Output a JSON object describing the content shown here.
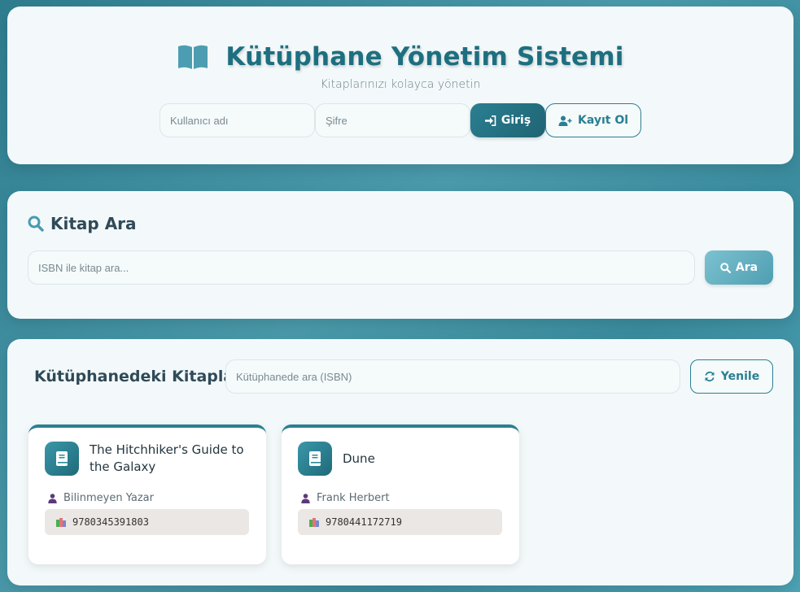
{
  "header": {
    "title": "Kütüphane Yönetim Sistemi",
    "subtitle": "Kitaplarınızı kolayca yönetin",
    "username_placeholder": "Kullanıcı adı",
    "password_placeholder": "Şifre",
    "login_label": "Giriş",
    "register_label": "Kayıt Ol"
  },
  "search": {
    "title": "Kitap Ara",
    "placeholder": "ISBN ile kitap ara...",
    "button_label": "Ara"
  },
  "library": {
    "title": "Kütüphanedeki Kitaplar",
    "search_placeholder": "Kütüphanede ara (ISBN)",
    "refresh_label": "Yenile",
    "books": [
      {
        "title": "The Hitchhiker's Guide to the Galaxy",
        "author": "Bilinmeyen Yazar",
        "isbn": "9780345391803"
      },
      {
        "title": "Dune",
        "author": "Frank Herbert",
        "isbn": "9780441172719"
      }
    ]
  },
  "colors": {
    "accent": "#2a7f92",
    "title": "#1d6f80",
    "background": "#3a8c9e"
  },
  "icons": {
    "header": "open-book-icon",
    "login": "sign-in-icon",
    "register": "user-plus-icon",
    "search": "search-icon",
    "refresh": "refresh-icon",
    "book": "book-icon",
    "author": "user-icon",
    "isbn": "books-stack-icon"
  }
}
